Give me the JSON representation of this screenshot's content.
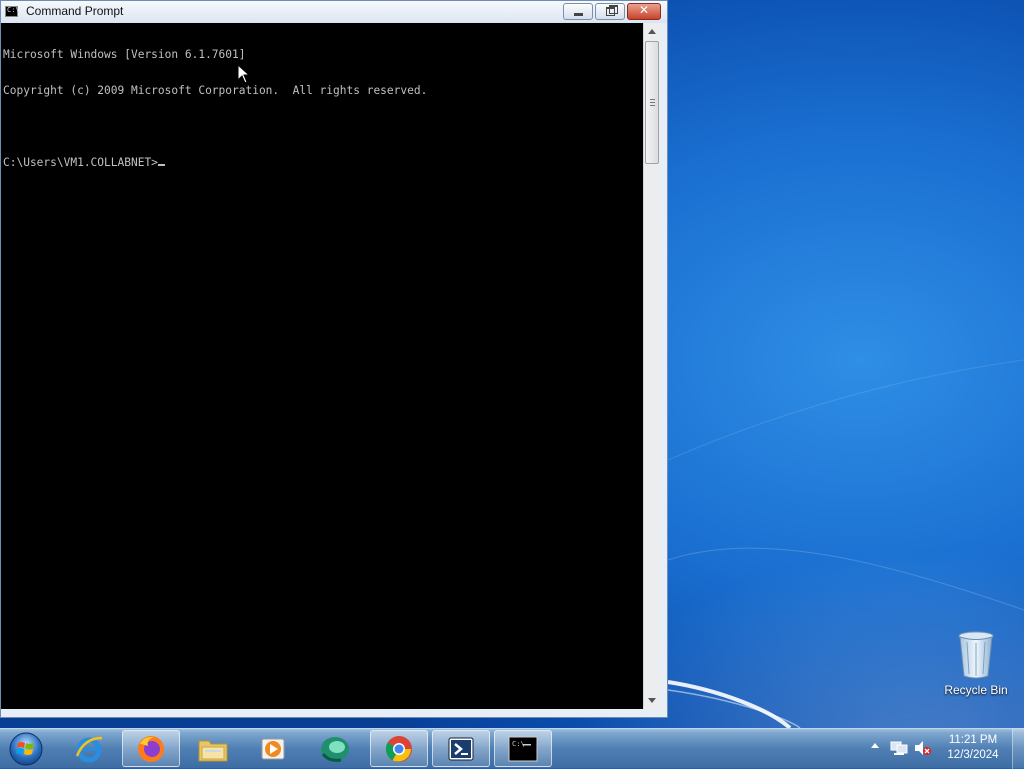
{
  "window": {
    "title": "Command Prompt",
    "title_icon_text": "C:\\",
    "buttons": {
      "minimize": "minimize",
      "maximize": "restore",
      "close": "✕"
    }
  },
  "console": {
    "lines": [
      "Microsoft Windows [Version 6.1.7601]",
      "Copyright (c) 2009 Microsoft Corporation.  All rights reserved.",
      "",
      "C:\\Users\\VM1.COLLABNET>"
    ],
    "text_color": "#c0c0c0",
    "background": "#000000"
  },
  "desktop": {
    "icons": [
      {
        "label": "Recycle Bin",
        "icon": "recycle-bin-icon"
      }
    ]
  },
  "taskbar": {
    "start": "windows-start-orb-icon",
    "items": [
      {
        "name": "internet-explorer",
        "icon": "internet-explorer-icon",
        "active": false
      },
      {
        "name": "firefox",
        "icon": "firefox-icon",
        "active": true
      },
      {
        "name": "file-explorer",
        "icon": "folder-icon",
        "active": false
      },
      {
        "name": "media-player",
        "icon": "media-player-icon",
        "active": false
      },
      {
        "name": "green-app",
        "icon": "green-app-icon",
        "active": false
      },
      {
        "name": "chrome",
        "icon": "chrome-icon",
        "active": true
      },
      {
        "name": "powershell",
        "icon": "powershell-icon",
        "active": true
      },
      {
        "name": "command-prompt",
        "icon": "cmd-icon",
        "active": true
      }
    ],
    "tray": {
      "clock_time": "11:21 PM",
      "clock_date": "12/3/2024",
      "icons": [
        "show-hidden-icons-arrow",
        "network-icon",
        "volume-muted-icon"
      ]
    }
  }
}
